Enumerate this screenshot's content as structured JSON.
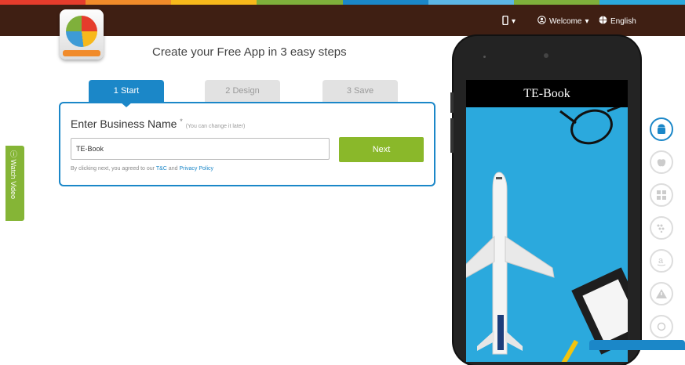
{
  "colors": {
    "stripe": [
      "#e53c2c",
      "#f18b2a",
      "#f7b81b",
      "#7fb03b",
      "#1b87c8",
      "#5cb6e5",
      "#7fb03b",
      "#2ba9dd"
    ],
    "topbar": "#3f1f13",
    "accent": "#1b87c8",
    "next": "#8ab82a"
  },
  "header": {
    "logo_icon": "pie-chart-app-icon",
    "device_menu": {
      "icon": "mobile-icon",
      "caret": "▾"
    },
    "welcome": {
      "icon": "user-icon",
      "label": "Welcome",
      "caret": "▾"
    },
    "language": {
      "icon": "globe-icon",
      "label": "English"
    }
  },
  "main": {
    "headline": "Create your Free App in 3 easy steps",
    "tabs": [
      {
        "label": "1 Start",
        "active": true
      },
      {
        "label": "2 Design",
        "active": false
      },
      {
        "label": "3 Save",
        "active": false
      }
    ],
    "form": {
      "title": "Enter Business Name",
      "required_mark": "*",
      "hint": "(You can change it later)",
      "input_value": "TE-Book",
      "next_label": "Next",
      "agree_prefix": "By clicking next, you agreed to our",
      "tc_link": "T&C",
      "and": "and",
      "privacy_link": "Privacy Policy"
    }
  },
  "watch_video": {
    "label": "Watch Video",
    "icon": "help-circle-icon"
  },
  "preview": {
    "app_title": "TE-Book",
    "background_icon": "airplane-icon"
  },
  "platforms": [
    {
      "name": "android",
      "glyph": "🤖",
      "active": true
    },
    {
      "name": "apple",
      "glyph": "",
      "active": false
    },
    {
      "name": "windows",
      "glyph": "⊞",
      "active": false
    },
    {
      "name": "blackberry",
      "glyph": "⁂",
      "active": false
    },
    {
      "name": "amazon",
      "glyph": "a",
      "active": false
    },
    {
      "name": "warning",
      "glyph": "⚠",
      "active": false
    },
    {
      "name": "more",
      "glyph": "◌",
      "active": false
    }
  ]
}
